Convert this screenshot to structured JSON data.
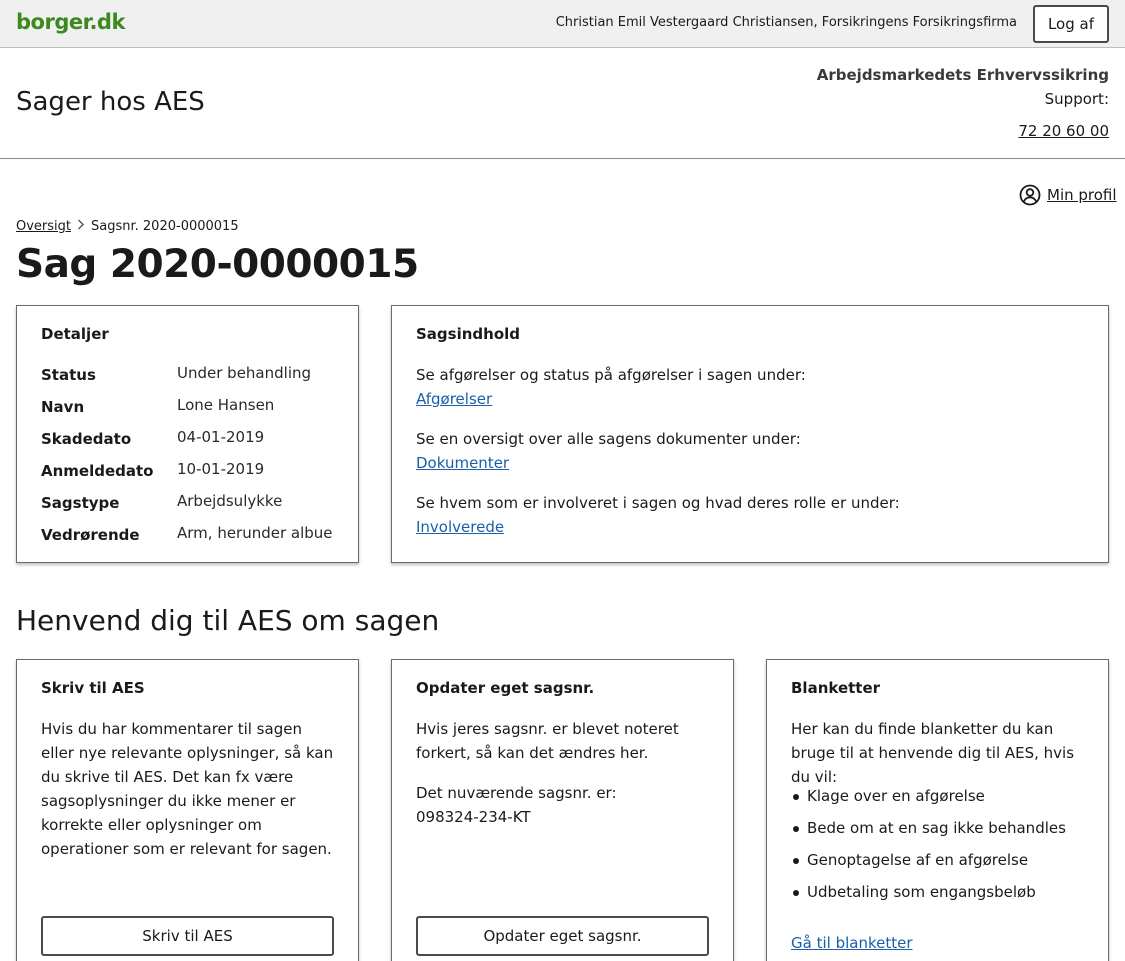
{
  "topbar": {
    "logo": "borger.dk",
    "user": "Christian Emil Vestergaard Christiansen, Forsikringens Forsikringsfirma",
    "logout_label": "Log af"
  },
  "header": {
    "title": "Sager hos AES",
    "org": "Arbejdsmarkedets Erhvervssikring",
    "support_label": "Support:",
    "support_phone": "72 20 60 00"
  },
  "profile": {
    "label": "Min profil",
    "icon": "user-circle-icon"
  },
  "breadcrumb": {
    "root": "Oversigt",
    "separator_icon": "chevron-right-icon",
    "current": "Sagsnr. 2020-0000015"
  },
  "page_title": "Sag 2020-0000015",
  "details": {
    "title": "Detaljer",
    "rows": [
      {
        "key": "Status",
        "value": "Under behandling"
      },
      {
        "key": "Navn",
        "value": "Lone Hansen"
      },
      {
        "key": "Skadedato",
        "value": "04-01-2019"
      },
      {
        "key": "Anmeldedato",
        "value": "10-01-2019"
      },
      {
        "key": "Sagstype",
        "value": "Arbejdsulykke"
      },
      {
        "key": "Vedrørende",
        "value": "Arm, herunder albue"
      }
    ]
  },
  "content": {
    "title": "Sagsindhold",
    "items": [
      {
        "text": "Se afgørelser og status på afgørelser i sagen under:",
        "link": "Afgørelser"
      },
      {
        "text": "Se en oversigt over alle sagens dokumenter under:",
        "link": "Dokumenter"
      },
      {
        "text": "Se hvem som er involveret i sagen og hvad deres rolle er under:",
        "link": "Involverede"
      }
    ]
  },
  "contact_section_title": "Henvend dig til AES om sagen",
  "write": {
    "title": "Skriv til AES",
    "text": "Hvis du har kommentarer til sagen eller nye relevante oplysninger, så kan du skrive til AES. Det kan fx være sagsoplysninger du ikke mener er korrekte eller oplysninger om operationer som er relevant for sagen.",
    "button": "Skriv til AES"
  },
  "update": {
    "title": "Opdater eget sagsnr.",
    "text": "Hvis jeres sagsnr. er blevet noteret forkert, så kan det ændres her.",
    "current_label": "Det nuværende sagsnr. er:",
    "current_value": "098324-234-KT",
    "button": "Opdater eget sagsnr."
  },
  "forms": {
    "title": "Blanketter",
    "text": "Her kan du finde blanketter du kan bruge til at henvende dig til AES, hvis du vil:",
    "items": [
      "Klage over en afgørelse",
      "Bede om at en sag ikke behandles",
      "Genoptagelse af en afgørelse",
      "Udbetaling som engangsbeløb"
    ],
    "link": "Gå til blanketter"
  },
  "colors": {
    "brand_green": "#3c8a1e",
    "link_blue": "#1a5fa8"
  }
}
